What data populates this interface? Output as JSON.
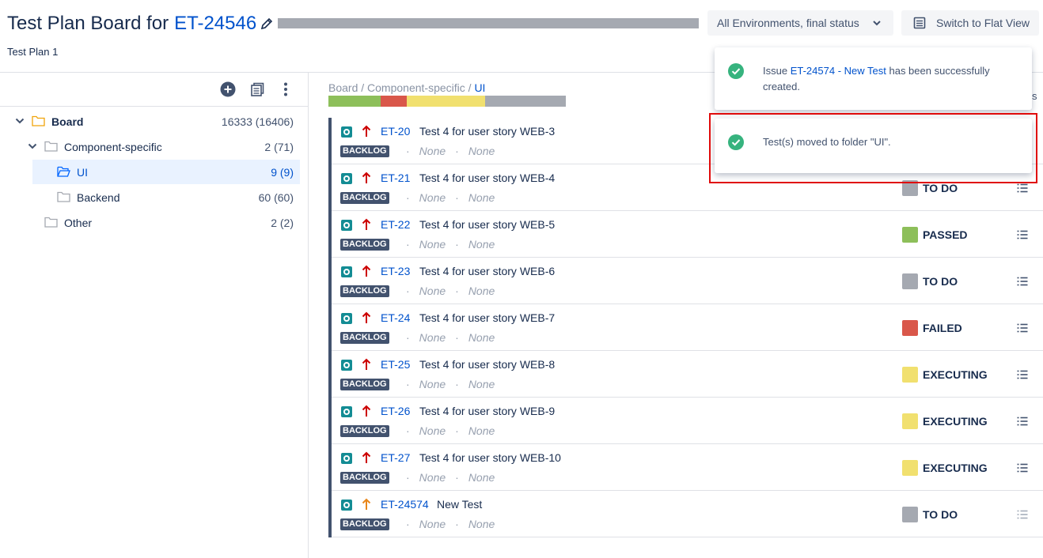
{
  "header": {
    "title_prefix": "Test Plan Board for",
    "title_key": "ET-24546",
    "subtitle": "Test Plan 1",
    "env_select_label": "All Environments, final status",
    "flat_view_label": "Switch to Flat View"
  },
  "sidebar": {
    "tree": [
      {
        "label": "Board",
        "count": "16333 (16406)"
      },
      {
        "label": "Component-specific",
        "count": "2 (71)"
      },
      {
        "label": "UI",
        "count": "9 (9)"
      },
      {
        "label": "Backend",
        "count": "60 (60)"
      },
      {
        "label": "Other",
        "count": "2 (2)"
      }
    ]
  },
  "content": {
    "breadcrumb": {
      "part1": "Board",
      "sep": " / ",
      "part2": "Component-specific",
      "part3": "UI"
    },
    "progress": [
      {
        "status": "passed",
        "color": "#8dbf5a",
        "fraction": 0.22
      },
      {
        "status": "failed",
        "color": "#d9574a",
        "fraction": 0.11
      },
      {
        "status": "executing",
        "color": "#f1e06f",
        "fraction": 0.33
      },
      {
        "status": "todo",
        "color": "#a5a9b1",
        "fraction": 0.34
      }
    ],
    "truncated_text": "s",
    "tests": [
      {
        "key": "ET-20",
        "summary": "Test 4 for user story WEB-3",
        "badge": "BACKLOG",
        "meta1": "None",
        "meta2": "None",
        "status": "",
        "status_color": "",
        "priority_color": "#cc0000",
        "list_icon": false
      },
      {
        "key": "ET-21",
        "summary": "Test 4 for user story WEB-4",
        "badge": "BACKLOG",
        "meta1": "None",
        "meta2": "None",
        "status": "TO DO",
        "status_color": "#a5a9b1",
        "priority_color": "#cc0000",
        "list_icon": true
      },
      {
        "key": "ET-22",
        "summary": "Test 4 for user story WEB-5",
        "badge": "BACKLOG",
        "meta1": "None",
        "meta2": "None",
        "status": "PASSED",
        "status_color": "#8dbf5a",
        "priority_color": "#cc0000",
        "list_icon": true
      },
      {
        "key": "ET-23",
        "summary": "Test 4 for user story WEB-6",
        "badge": "BACKLOG",
        "meta1": "None",
        "meta2": "None",
        "status": "TO DO",
        "status_color": "#a5a9b1",
        "priority_color": "#cc0000",
        "list_icon": true
      },
      {
        "key": "ET-24",
        "summary": "Test 4 for user story WEB-7",
        "badge": "BACKLOG",
        "meta1": "None",
        "meta2": "None",
        "status": "FAILED",
        "status_color": "#d9574a",
        "priority_color": "#cc0000",
        "list_icon": true
      },
      {
        "key": "ET-25",
        "summary": "Test 4 for user story WEB-8",
        "badge": "BACKLOG",
        "meta1": "None",
        "meta2": "None",
        "status": "EXECUTING",
        "status_color": "#f1e06f",
        "priority_color": "#cc0000",
        "list_icon": true
      },
      {
        "key": "ET-26",
        "summary": "Test 4 for user story WEB-9",
        "badge": "BACKLOG",
        "meta1": "None",
        "meta2": "None",
        "status": "EXECUTING",
        "status_color": "#f1e06f",
        "priority_color": "#cc0000",
        "list_icon": true
      },
      {
        "key": "ET-27",
        "summary": "Test 4 for user story WEB-10",
        "badge": "BACKLOG",
        "meta1": "None",
        "meta2": "None",
        "status": "EXECUTING",
        "status_color": "#f1e06f",
        "priority_color": "#cc0000",
        "list_icon": true
      },
      {
        "key": "ET-24574",
        "summary": "New Test",
        "badge": "BACKLOG",
        "meta1": "None",
        "meta2": "None",
        "status": "TO DO",
        "status_color": "#a5a9b1",
        "priority_color": "#e8861a",
        "list_icon": true
      }
    ]
  },
  "toasts": [
    {
      "text_before": "Issue",
      "link": "ET-24574 - New Test",
      "text_after": "has been successfully created."
    },
    {
      "text": "Test(s) moved to folder \"UI\"."
    }
  ],
  "colors": {
    "success": "#36b37e",
    "link": "#0052cc",
    "highlight": "#e00b0b"
  }
}
